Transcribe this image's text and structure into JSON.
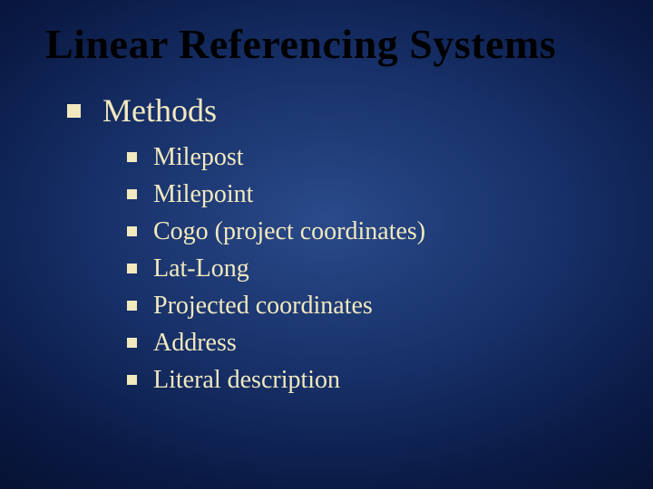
{
  "title": "Linear Referencing Systems",
  "section": "Methods",
  "items": [
    "Milepost",
    "Milepoint",
    "Cogo (project coordinates)",
    "Lat-Long",
    "Projected coordinates",
    "Address",
    "Literal description"
  ]
}
